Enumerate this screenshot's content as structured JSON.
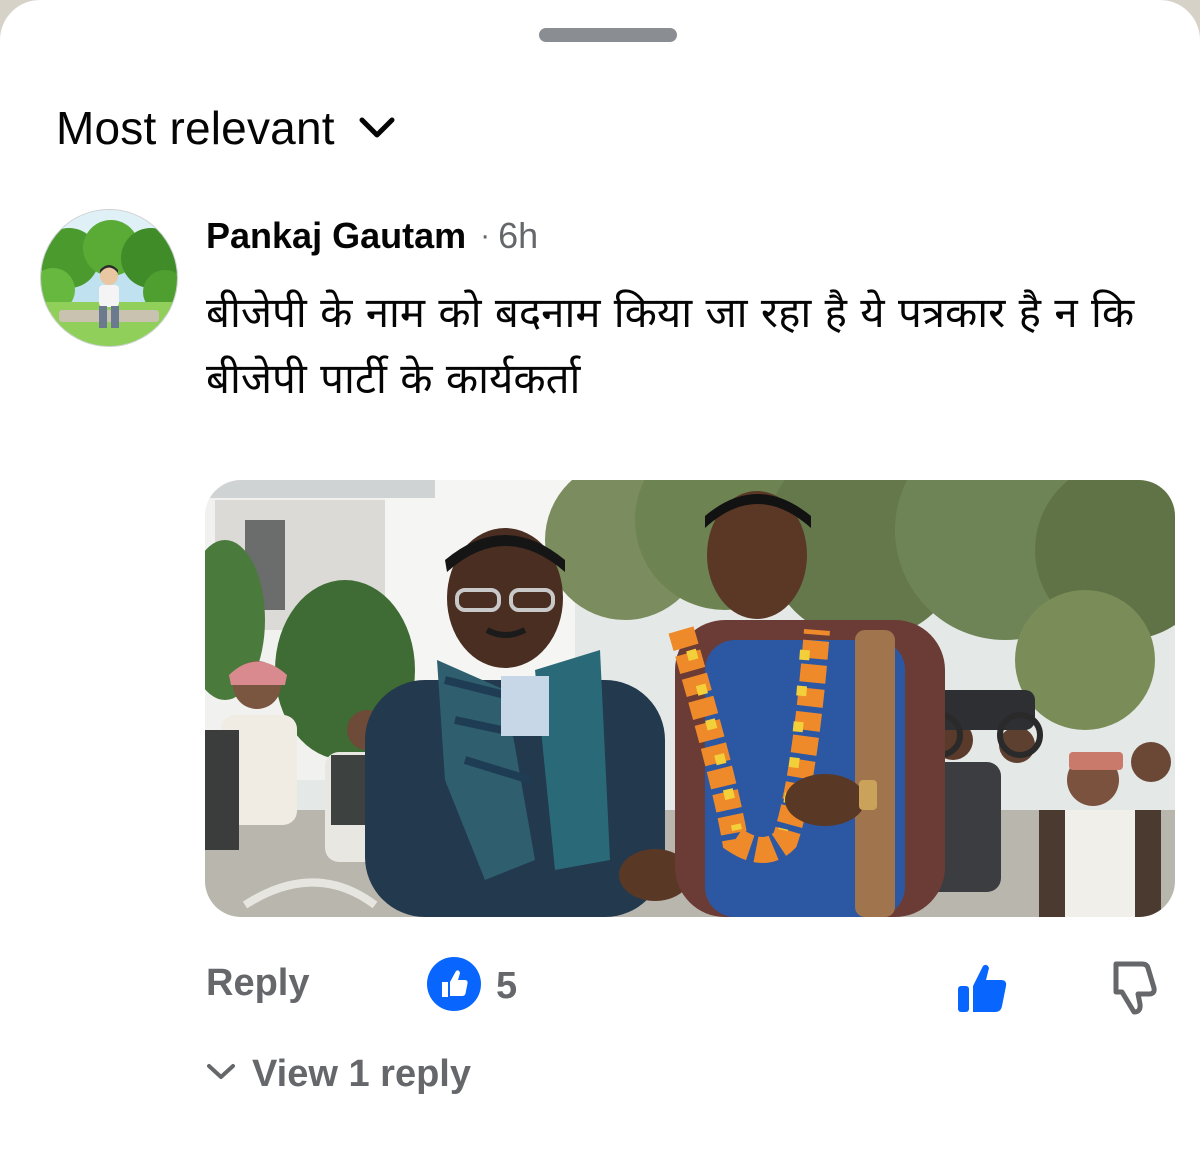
{
  "sheet": {
    "sort": {
      "label": "Most relevant",
      "icon": "chevron-down-icon"
    }
  },
  "comment": {
    "author": "Pankaj Gautam",
    "separator": "·",
    "time": "6h",
    "text": "बीजेपी के नाम को बदनाम किया जा रहा है ये पत्रकार है न कि बीजेपी पार्टी के कार्यकर्ता",
    "avatar_icon": "user-avatar-icon",
    "attachment_icon": "photo-attachment",
    "actions": {
      "reply_label": "Reply",
      "reaction_icon": "like-reaction-icon",
      "reaction_count": "5",
      "like_icon": "thumbs-up-icon",
      "dislike_icon": "thumbs-down-icon"
    },
    "replies": {
      "icon": "chevron-down-icon",
      "label": "View 1 reply"
    }
  },
  "colors": {
    "text_primary": "#050505",
    "text_secondary": "#65676b",
    "accent": "#0866ff",
    "handle": "#8a8d91"
  }
}
